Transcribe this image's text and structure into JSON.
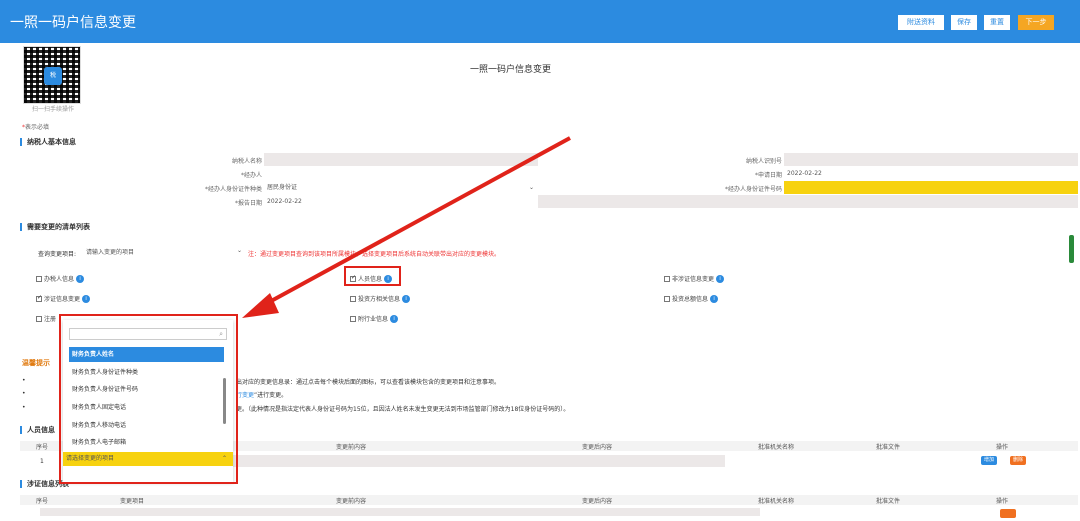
{
  "app": {
    "title": "一照一码户信息变更"
  },
  "toolbar": {
    "attach": "附送资料",
    "save": "保存",
    "reset": "重置",
    "next": "下一步"
  },
  "qr": {
    "caption": "扫一扫手续操作"
  },
  "page": {
    "title": "一照一码户信息变更",
    "required_star": "*",
    "required_note": "表示必填"
  },
  "basic": {
    "heading": "纳税人基本信息",
    "taxpayer_name_label": "纳税人名称",
    "taxpayer_id_label": "纳税人识别号",
    "agent_label": "*经办人",
    "apply_date_label": "*申请日期",
    "apply_date": "2022-02-22",
    "id_type_label": "*经办人身份证件种类",
    "id_type_value": "居民身份证",
    "id_no_label": "*经办人身份证件号码",
    "report_date_label": "*报告日期",
    "report_date": "2022-02-22"
  },
  "changes": {
    "heading": "需要变更的清单列表",
    "query_label": "查询变更项目:",
    "query_placeholder": "请输入变更的项目",
    "note": "注：通过变更项目查询到该项目所属模块，选择变更项目后系统自动关联带出对应的变更模块。",
    "checks": [
      {
        "label": "办税人信息",
        "checked": false
      },
      {
        "label": "人员信息",
        "checked": true
      },
      {
        "label": "非涉证信息变更",
        "checked": false
      },
      {
        "label": "涉证信息变更",
        "checked": true
      },
      {
        "label": "投资方相关信息",
        "checked": false
      },
      {
        "label": "投资总额信息",
        "checked": false
      },
      {
        "label": "注册",
        "checked": false
      },
      {
        "label": "附行业信息",
        "checked": false
      }
    ]
  },
  "dropdown": {
    "items": [
      "财务负责人姓名",
      "财务负责人身份证件种类",
      "财务负责人身份证件号码",
      "财务负责人固定电话",
      "财务负责人移动电话",
      "财务负责人电子邮箱"
    ],
    "footer": "请选择变更的项目"
  },
  "warning": {
    "heading": "温馨提示",
    "line1_tail": "出对应的变更信息录：通过点击每个模块后面的图标，可以查看该模块包含的变更项目和注意事项。",
    "line2_link": "行变更",
    "line2_tail": "”进行变更。",
    "line3_tail": "更。（此种情况是指法定代表人身份证号码为15位，且因法人姓名未发生变更无法到市场监管部门修改为18位身份证号码的）。"
  },
  "persons": {
    "heading": "人员信息",
    "cols": [
      "序号",
      "变更前内容",
      "变更后内容",
      "批准机关名称",
      "批准文件",
      "操作"
    ],
    "row_no": "1",
    "add": "增加",
    "delete": "删除"
  },
  "certs": {
    "heading": "涉证信息列表",
    "cols": [
      "序号",
      "变更项目",
      "变更前内容",
      "变更后内容",
      "批准机关名称",
      "批准文件",
      "操作"
    ]
  }
}
